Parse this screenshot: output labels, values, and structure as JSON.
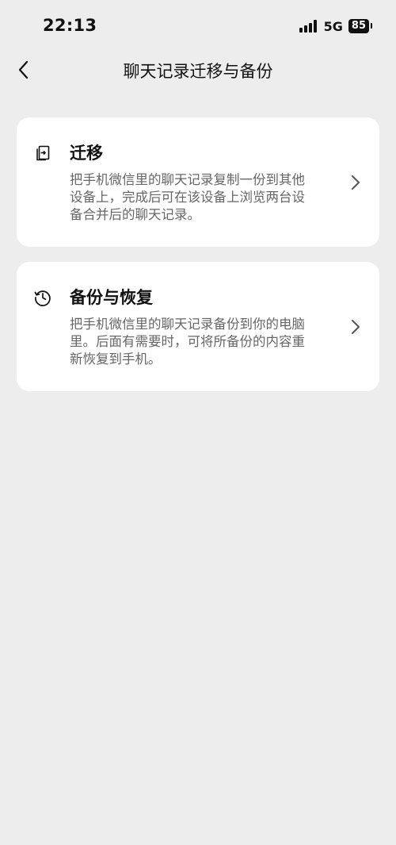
{
  "status_bar": {
    "time": "22:13",
    "network": "5G",
    "battery": "85"
  },
  "header": {
    "title": "聊天记录迁移与备份",
    "back_icon": "chevron-left-icon"
  },
  "options": [
    {
      "icon": "migrate-icon",
      "title": "迁移",
      "description": "把手机微信里的聊天记录复制一份到其他设备上，完成后可在该设备上浏览两台设备合并后的聊天记录。"
    },
    {
      "icon": "history-icon",
      "title": "备份与恢复",
      "description": "把手机微信里的聊天记录备份到你的电脑里。后面有需要时，可将所备份的内容重新恢复到手机。"
    }
  ],
  "colors": {
    "background": "#ededed",
    "card": "#ffffff",
    "text_primary": "#111111",
    "text_secondary": "#666666",
    "chevron": "#555555"
  }
}
